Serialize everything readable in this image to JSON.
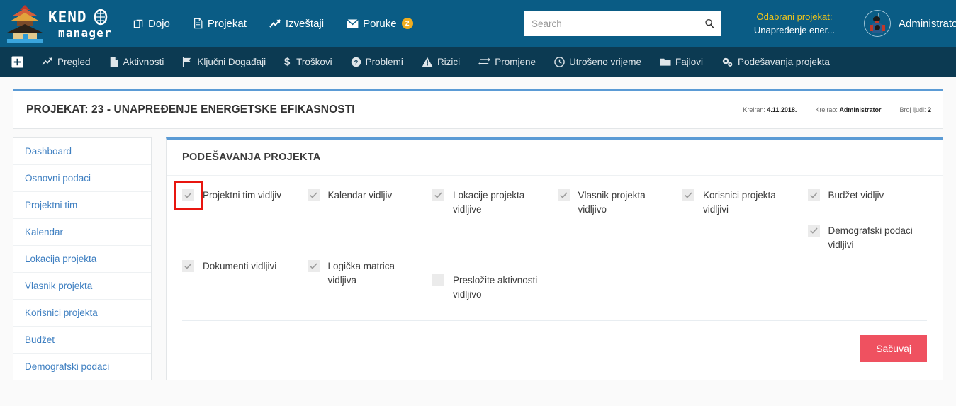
{
  "brand": {
    "name_top": "KENDO",
    "name_bottom": "manager"
  },
  "header": {
    "nav": [
      {
        "label": "Dojo",
        "icon": "copy-icon"
      },
      {
        "label": "Projekat",
        "icon": "document-icon"
      },
      {
        "label": "Izveštaji",
        "icon": "chart-line-icon"
      },
      {
        "label": "Poruke",
        "icon": "envelope-icon",
        "badge": "2"
      }
    ],
    "search": {
      "placeholder": "Search",
      "value": ""
    },
    "selected_project": {
      "label": "Odabrani projekat:",
      "value": "Unapređenje ener..."
    },
    "user": {
      "name": "Administrator"
    }
  },
  "subnav": {
    "home_icon": "grid-plus-icon",
    "items": [
      {
        "label": "Pregled",
        "icon": "chart-line-icon"
      },
      {
        "label": "Aktivnosti",
        "icon": "file-icon"
      },
      {
        "label": "Ključni Događaji",
        "icon": "flag-icon"
      },
      {
        "label": "Troškovi",
        "icon": "dollar-icon"
      },
      {
        "label": "Problemi",
        "icon": "question-circle-icon"
      },
      {
        "label": "Rizici",
        "icon": "warning-triangle-icon"
      },
      {
        "label": "Promjene",
        "icon": "exchange-arrows-icon"
      },
      {
        "label": "Utrošeno vrijeme",
        "icon": "clock-icon"
      },
      {
        "label": "Fajlovi",
        "icon": "folder-icon"
      },
      {
        "label": "Podešavanja projekta",
        "icon": "gears-icon"
      }
    ]
  },
  "project_header": {
    "title": "PROJEKAT: 23 - UNAPREĐENJE ENERGETSKE EFIKASNOSTI",
    "meta": [
      {
        "label": "Kreiran:",
        "value": "4.11.2018."
      },
      {
        "label": "Kreirao:",
        "value": "Administrator"
      },
      {
        "label": "Broj ljudi:",
        "value": "2"
      }
    ]
  },
  "sidebar": {
    "items": [
      {
        "label": "Dashboard"
      },
      {
        "label": "Osnovni podaci"
      },
      {
        "label": "Projektni tim"
      },
      {
        "label": "Kalendar"
      },
      {
        "label": "Lokacija projekta"
      },
      {
        "label": "Vlasnik projekta"
      },
      {
        "label": "Korisnici projekta"
      },
      {
        "label": "Budžet"
      },
      {
        "label": "Demografski podaci"
      }
    ]
  },
  "panel": {
    "title": "PODEŠAVANJA PROJEKTA",
    "save_label": "Sačuvaj",
    "checkbox_columns": [
      {
        "items": [
          {
            "label": "Projektni tim vidljiv",
            "checked": true,
            "highlighted": true
          },
          {
            "label": "Dokumenti vidljivi",
            "checked": true,
            "highlighted": false
          }
        ]
      },
      {
        "items": [
          {
            "label": "Kalendar vidljiv",
            "checked": true,
            "highlighted": false
          },
          {
            "label": "Logička matrica vidljiva",
            "checked": true,
            "highlighted": false
          }
        ]
      },
      {
        "items": [
          {
            "label": "Lokacije projekta vidljive",
            "checked": true,
            "highlighted": false
          },
          {
            "label": "Presložite aktivnosti vidljivo",
            "checked": false,
            "highlighted": false
          }
        ]
      },
      {
        "items": [
          {
            "label": "Vlasnik projekta vidljivo",
            "checked": true,
            "highlighted": false
          }
        ]
      },
      {
        "items": [
          {
            "label": "Korisnici projekta vidljivi",
            "checked": true,
            "highlighted": false
          }
        ]
      },
      {
        "items": [
          {
            "label": "Budžet vidljiv",
            "checked": true,
            "highlighted": false
          },
          {
            "label": "Demografski podaci vidljivi",
            "checked": true,
            "highlighted": false
          }
        ]
      }
    ]
  },
  "colors": {
    "header_blue": "#0a5c85",
    "subnav_navy": "#0c3a52",
    "accent_blue": "#5b9bd5",
    "link_blue": "#3e7fc1",
    "save_red": "#ef5160",
    "badge_yellow": "#f0ad1e",
    "highlight_red": "#e8150f",
    "project_label_yellow": "#f0c419"
  }
}
